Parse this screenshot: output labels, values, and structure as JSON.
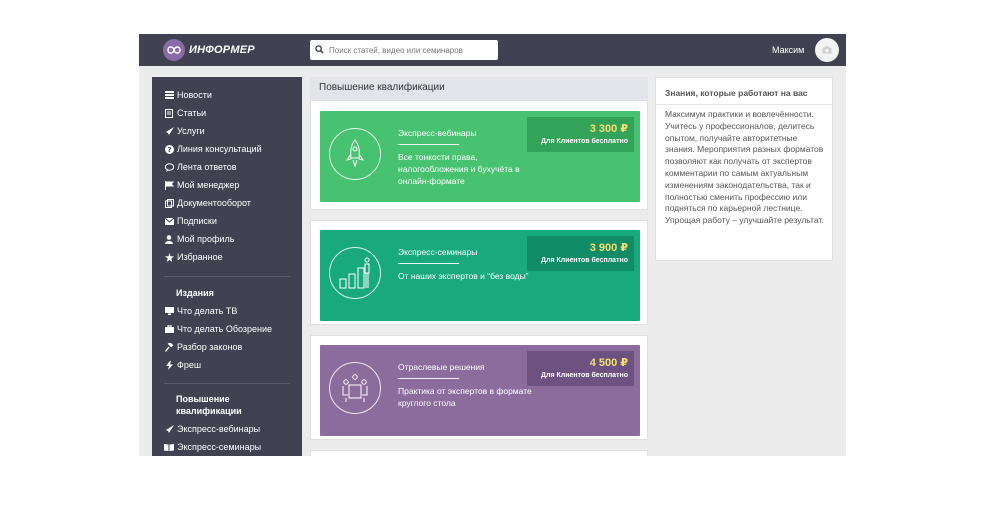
{
  "header": {
    "logo_text": "ИНФОРМЕР",
    "search_placeholder": "Поиск статей, видео или семинаров",
    "user_name": "Максим"
  },
  "sidebar": {
    "items": [
      {
        "label": "Новости",
        "icon": "list-icon"
      },
      {
        "label": "Статьи",
        "icon": "file-icon"
      },
      {
        "label": "Услуги",
        "icon": "rocket-icon"
      },
      {
        "label": "Линия консультаций",
        "icon": "question-icon"
      },
      {
        "label": "Лента ответов",
        "icon": "bubble-icon"
      },
      {
        "label": "Мой менеджер",
        "icon": "flag-icon"
      },
      {
        "label": "Документооборот",
        "icon": "docs-icon"
      },
      {
        "label": "Подписки",
        "icon": "mail-icon"
      },
      {
        "label": "Мой профиль",
        "icon": "user-icon"
      },
      {
        "label": "Избранное",
        "icon": "star-icon"
      }
    ],
    "section_publications": "Издания",
    "publications": [
      {
        "label": "Что делать ТВ",
        "icon": "tv-icon"
      },
      {
        "label": "Что делать Обозрение",
        "icon": "briefcase-icon"
      },
      {
        "label": "Разбор законов",
        "icon": "gavel-icon"
      },
      {
        "label": "Фреш",
        "icon": "bolt-icon"
      }
    ],
    "section_training": "Повышение квалификации",
    "training": [
      {
        "label": "Экспресс-вебинары",
        "icon": "rocket-icon"
      },
      {
        "label": "Экспресс-семинары",
        "icon": "book-icon"
      }
    ]
  },
  "main": {
    "title": "Повышение квалификации",
    "cards": [
      {
        "title": "Экспресс-вебинары",
        "description": "Все тонкости права, налогообложения и бухучёта в онлайн-формате",
        "price": "3 300 ₽",
        "price_note": "Для Клиентов бесплатно",
        "color": "#47c270",
        "price_bg": "#34a35a",
        "icon": "rocket-icon"
      },
      {
        "title": "Экспресс-семинары",
        "description": "От наших экспертов и “без воды”",
        "price": "3 900 ₽",
        "price_note": "Для Клиентов бесплатно",
        "color": "#18a97d",
        "price_bg": "#108c66",
        "icon": "growth-chart-icon"
      },
      {
        "title": "Отраслевые решения",
        "description": "Практика от экспертов в формате круглого стола",
        "price": "4 500 ₽",
        "price_note": "Для Клиентов бесплатно",
        "color": "#8b6c9d",
        "price_bg": "#6d5180",
        "icon": "roundtable-icon"
      }
    ]
  },
  "info": {
    "title": "Знания, которые работают на вас",
    "text": "Максимум практики и вовлечённости. Учитесь у профессионалов, делитесь опытом, получайте авторитетные знания. Мероприятия разных форматов позволяют как получать от экспертов комментарии по самым актуальным изменениям законодательства, так и полностью сменить профессию или подняться по карьерной лестнице. Упрощая работу – улучшайте результат."
  }
}
